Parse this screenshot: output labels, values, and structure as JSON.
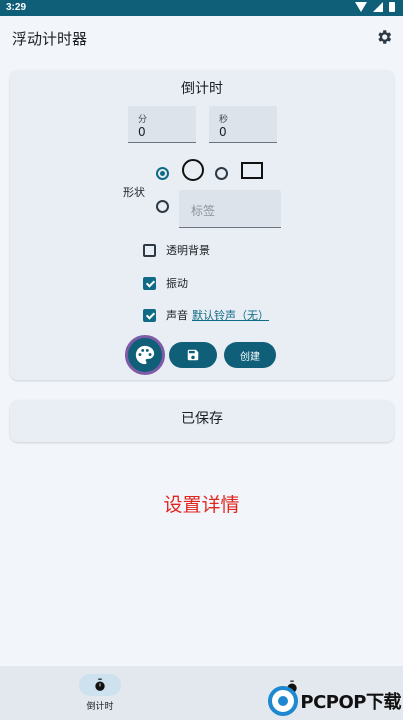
{
  "status_bar": {
    "time": "3:29"
  },
  "app_bar": {
    "title": "浮动计时器",
    "settings_icon": "gear-icon"
  },
  "countdown_card": {
    "title": "倒计时",
    "minutes": {
      "label": "分",
      "value": "0"
    },
    "seconds": {
      "label": "秒",
      "value": "0"
    },
    "shape": {
      "label": "形状",
      "options": [
        "circle",
        "rectangle",
        "label"
      ],
      "selected": "circle",
      "label_placeholder": "标签"
    },
    "transparent_bg": {
      "label": "透明背景",
      "checked": false
    },
    "vibrate": {
      "label": "振动",
      "checked": true
    },
    "sound": {
      "label": "声音",
      "checked": true,
      "ringtone": "默认铃声（无）"
    },
    "buttons": {
      "create": "创建"
    }
  },
  "saved_card": {
    "title": "已保存"
  },
  "details_link": "设置详情",
  "bottom_nav": {
    "items": [
      {
        "label": "倒计时",
        "active": true
      }
    ]
  },
  "watermark": {
    "text": "PCPOP下载"
  },
  "colors": {
    "primary": "#0f5f78",
    "accent_red": "#e0261e",
    "palette_ring": "#7d5ba6"
  }
}
